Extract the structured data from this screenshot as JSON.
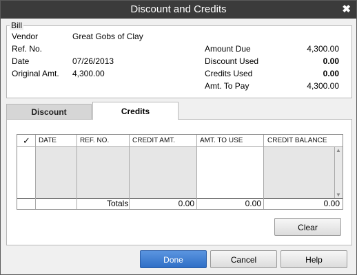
{
  "window": {
    "title": "Discount and Credits",
    "close_glyph": "✖"
  },
  "bill": {
    "section_label": "Bill",
    "vendor_label": "Vendor",
    "vendor_value": "Great Gobs of Clay",
    "refno_label": "Ref. No.",
    "refno_value": "",
    "date_label": "Date",
    "date_value": "07/26/2013",
    "origamt_label": "Original Amt.",
    "origamt_value": "4,300.00",
    "amount_due_label": "Amount Due",
    "amount_due_value": "4,300.00",
    "discount_used_label": "Discount Used",
    "discount_used_value": "0.00",
    "credits_used_label": "Credits Used",
    "credits_used_value": "0.00",
    "amt_to_pay_label": "Amt. To Pay",
    "amt_to_pay_value": "4,300.00"
  },
  "tabs": [
    {
      "label": "Discount",
      "selected": false
    },
    {
      "label": "Credits",
      "selected": true
    }
  ],
  "grid": {
    "check_header": "✓",
    "columns": [
      "DATE",
      "REF. NO.",
      "CREDIT AMT.",
      "AMT. TO USE",
      "CREDIT BALANCE"
    ],
    "rows": [],
    "totals_label": "Totals",
    "total_credit_amt": "0.00",
    "total_amt_to_use": "0.00",
    "total_credit_balance": "0.00",
    "scroll_up": "▲",
    "scroll_down": "▼"
  },
  "buttons": {
    "clear": "Clear",
    "done": "Done",
    "cancel": "Cancel",
    "help": "Help"
  },
  "colors": {
    "titlebar": "#3b3b3b",
    "primary_button": "#2f6fc6",
    "gray_column": "#e6e6e6"
  }
}
